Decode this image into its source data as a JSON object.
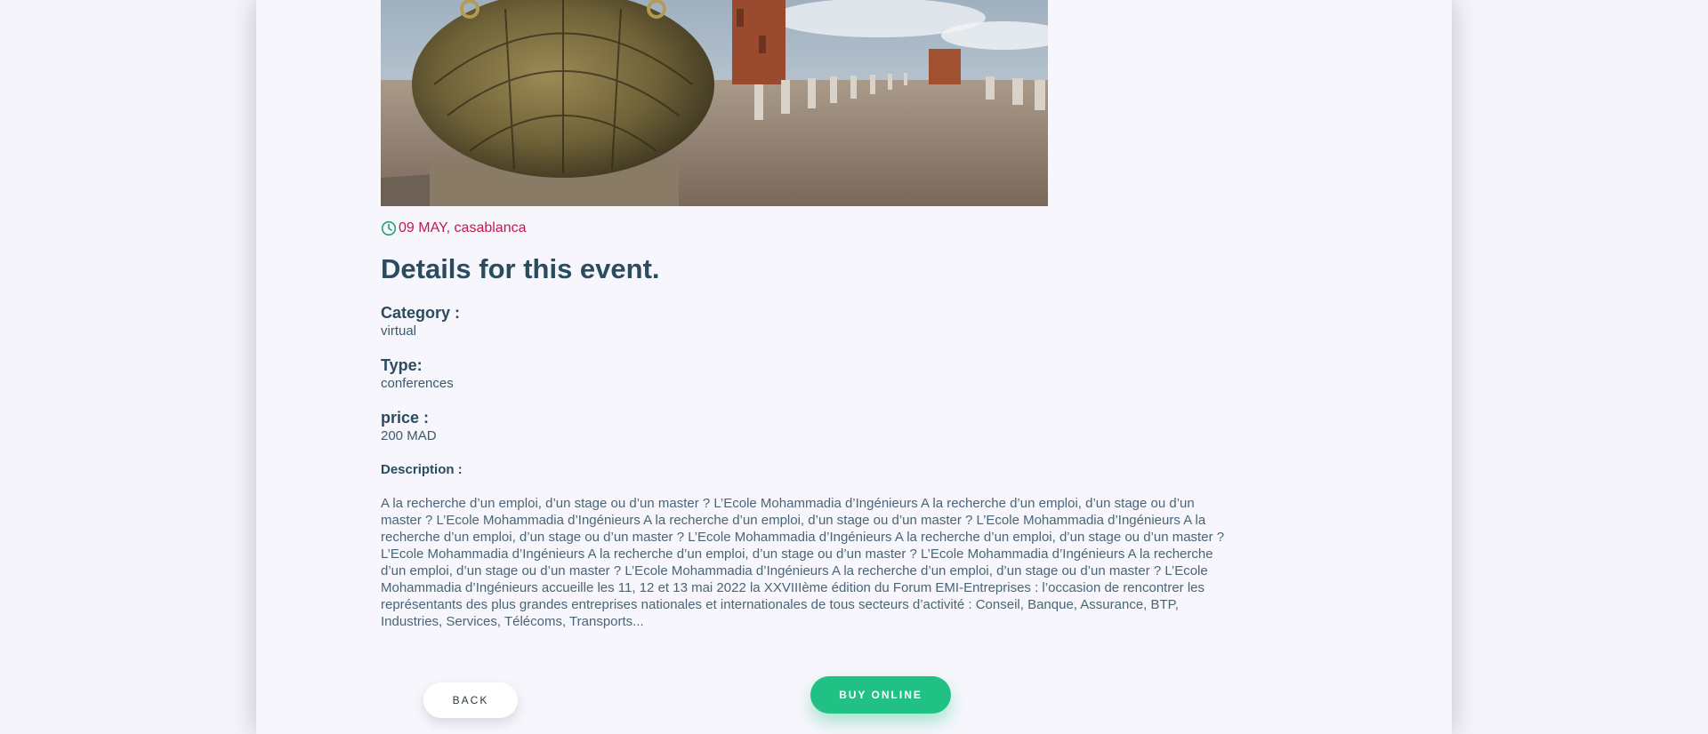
{
  "event": {
    "date_location": "09 MAY, casablanca",
    "details_title": "Details for this event.",
    "category_label": "Category :",
    "category_value": "virtual",
    "type_label": "Type:",
    "type_value": "conferences",
    "price_label": "price :",
    "price_value": "200 MAD",
    "description_label": "Description :",
    "description_text": "A la recherche d’un emploi, d’un stage ou d’un master ? L’Ecole Mohammadia d’Ingénieurs A la recherche d’un emploi, d’un stage ou d’un master ? L’Ecole Mohammadia d’Ingénieurs A la recherche d’un emploi, d’un stage ou d’un master ? L’Ecole Mohammadia d’Ingénieurs A la recherche d’un emploi, d’un stage ou d’un master ? L’Ecole Mohammadia d’Ingénieurs A la recherche d’un emploi, d’un stage ou d’un master ? L’Ecole Mohammadia d’Ingénieurs A la recherche d’un emploi, d’un stage ou d’un master ? L’Ecole Mohammadia d’Ingénieurs A la recherche d’un emploi, d’un stage ou d’un master ? L’Ecole Mohammadia d’Ingénieurs A la recherche d’un emploi, d’un stage ou d’un master ? L’Ecole Mohammadia d’Ingénieurs accueille les 11, 12 et 13 mai 2022 la XXVIIIème édition du Forum EMI-Entreprises : l’occasion de rencontrer les représentants des plus grandes entreprises nationales et internationales de tous secteurs d’activité : Conseil, Banque, Assurance, BTP, Industries, Services, Télécoms, Transports..."
  },
  "actions": {
    "back_label": "BACK",
    "buy_label": "BUY ONLINE"
  },
  "icons": {
    "date_icon": "clock-icon"
  },
  "colors": {
    "accent_green": "#21c186",
    "date_red": "#c1194c",
    "heading": "#2b4b5e",
    "background": "#f6f6fc"
  }
}
